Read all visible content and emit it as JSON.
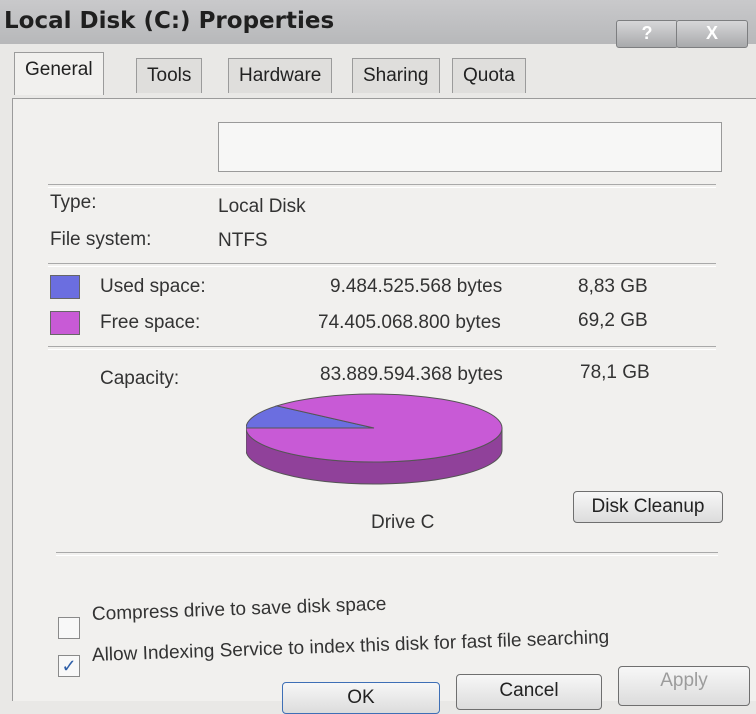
{
  "window": {
    "title": "Local Disk (C:) Properties",
    "help_glyph": "?",
    "close_glyph": "X"
  },
  "tabs": [
    {
      "label": "General",
      "active": true
    },
    {
      "label": "Tools",
      "active": false
    },
    {
      "label": "Hardware",
      "active": false
    },
    {
      "label": "Sharing",
      "active": false
    },
    {
      "label": "Quota",
      "active": false
    }
  ],
  "general": {
    "drive_label_value": "",
    "type_label": "Type:",
    "type_value": "Local Disk",
    "fs_label": "File system:",
    "fs_value": "NTFS",
    "used": {
      "label": "Used space:",
      "bytes": "9.484.525.568 bytes",
      "size": "8,83 GB",
      "color": "#6b6ee0"
    },
    "free": {
      "label": "Free space:",
      "bytes": "74.405.068.800 bytes",
      "size": "69,2 GB",
      "color": "#c85ad6"
    },
    "capacity": {
      "label": "Capacity:",
      "bytes": "83.889.594.368 bytes",
      "size": "78,1 GB"
    },
    "drive_caption": "Drive C",
    "disk_cleanup_label": "Disk Cleanup",
    "compress": {
      "label": "Compress drive to save disk space",
      "checked": false
    },
    "indexing": {
      "label": "Allow Indexing Service to index this disk for fast file searching",
      "checked": true,
      "check_glyph": "✓"
    }
  },
  "buttons": {
    "ok": "OK",
    "cancel": "Cancel",
    "apply": "Apply"
  },
  "chart_data": {
    "type": "pie",
    "labels": [
      "Used space",
      "Free space"
    ],
    "values": [
      9484525568,
      74405068800
    ],
    "colors": [
      "#6b6ee0",
      "#c85ad6"
    ],
    "title": "Drive C"
  }
}
